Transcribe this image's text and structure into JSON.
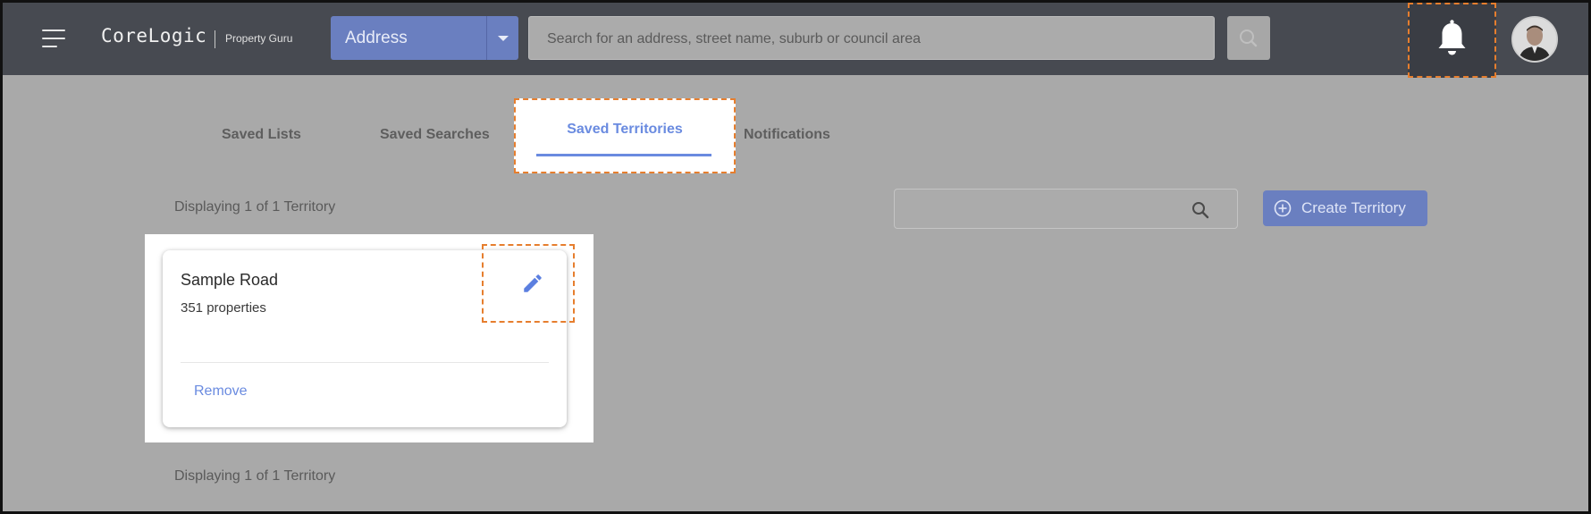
{
  "header": {
    "logo": "CoreLogic",
    "logo_sub": "Property Guru",
    "search_type": "Address",
    "search_placeholder": "Search for an address, street name, suburb or council area"
  },
  "tabs": [
    {
      "label": "Saved Lists",
      "active": false
    },
    {
      "label": "Saved Searches",
      "active": false
    },
    {
      "label": "Saved Territories",
      "active": true
    },
    {
      "label": "Notifications",
      "active": false
    }
  ],
  "display_count_top": "Displaying 1 of 1 Territory",
  "display_count_bottom": "Displaying 1 of 1 Territory",
  "filter": {
    "placeholder": ""
  },
  "create_button": "Create Territory",
  "territories": [
    {
      "name": "Sample Road",
      "count": "351 properties",
      "remove_label": "Remove"
    }
  ],
  "colors": {
    "header_bg": "#474a51",
    "accent": "#6a8be0",
    "button": "#6a7fc0",
    "highlight": "#e67e2e",
    "overlay": "#a9a9a9"
  },
  "icons": [
    "menu-icon",
    "chevron-down-icon",
    "search-icon",
    "bell-icon",
    "avatar",
    "plus-circle-icon",
    "pencil-icon"
  ]
}
